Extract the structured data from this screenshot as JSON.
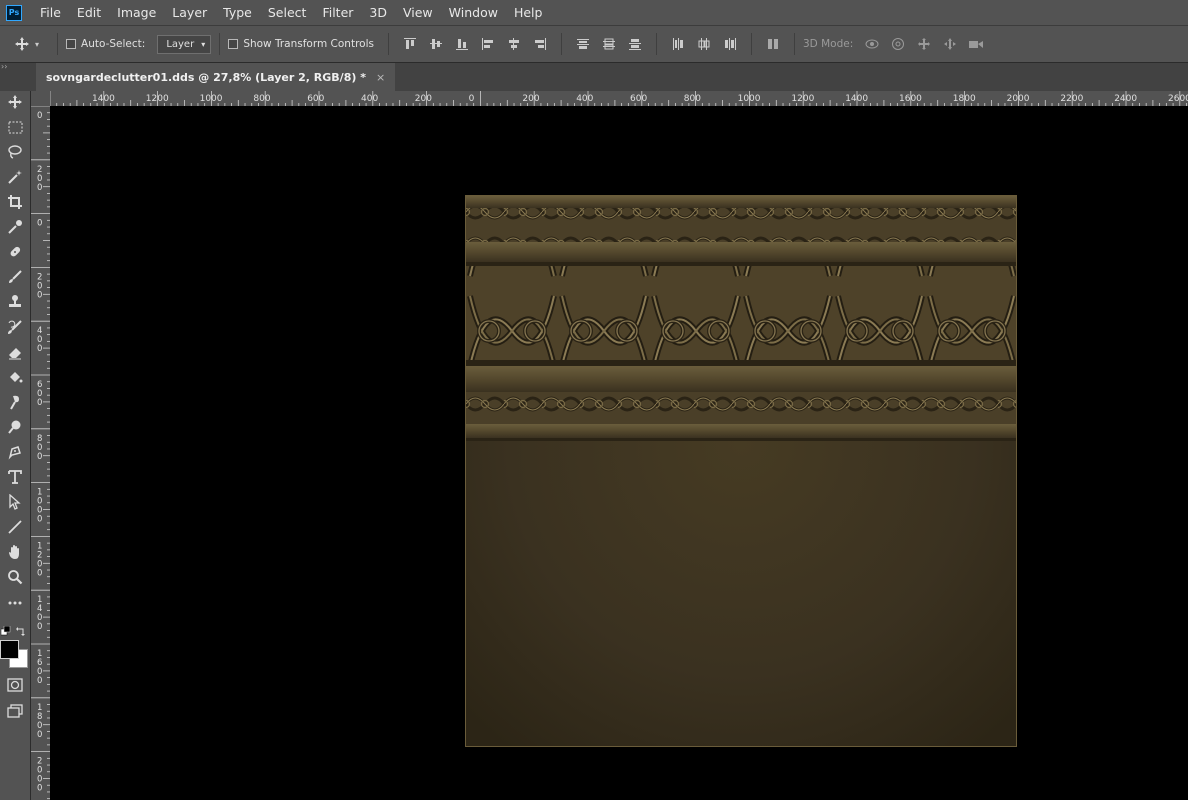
{
  "app": {
    "logo_text": "Ps"
  },
  "menu": [
    "File",
    "Edit",
    "Image",
    "Layer",
    "Type",
    "Select",
    "Filter",
    "3D",
    "View",
    "Window",
    "Help"
  ],
  "options": {
    "auto_select_label": "Auto-Select:",
    "auto_select_checked": false,
    "target_value": "Layer",
    "transform_label": "Show Transform Controls",
    "transform_checked": false,
    "mode_3d_label": "3D Mode:"
  },
  "document": {
    "tab_title": "sovngardeclutter01.dds @ 27,8% (Layer 2, RGB/8) *",
    "close_glyph": "×"
  },
  "ruler": {
    "h_labels": [
      "1400",
      "1200",
      "1000",
      "800",
      "600",
      "400",
      "200",
      "0",
      "200",
      "400",
      "600",
      "800",
      "1000",
      "1200",
      "1400",
      "1600",
      "1800",
      "2000",
      "2200",
      "2400",
      "2600"
    ],
    "v_labels": [
      "0",
      "200",
      "0",
      "200",
      "400",
      "600",
      "800",
      "1000",
      "1200",
      "1400",
      "1600",
      "1800",
      "2000",
      "2"
    ]
  },
  "colors": {
    "foreground": "#000000",
    "background": "#ffffff",
    "panel": "#535353",
    "texture_base": "#3b3220"
  },
  "tools": [
    "move-icon",
    "marquee-icon",
    "lasso-icon",
    "magic-wand-icon",
    "crop-icon",
    "eyedropper-icon",
    "healing-brush-icon",
    "brush-icon",
    "clone-stamp-icon",
    "history-brush-icon",
    "eraser-icon",
    "paint-bucket-icon",
    "smudge-icon",
    "dodge-icon",
    "pen-icon",
    "type-icon",
    "path-select-icon",
    "line-icon",
    "hand-icon",
    "zoom-icon",
    "more-tools-icon",
    "quick-mask-icon",
    "screen-mode-icon"
  ]
}
